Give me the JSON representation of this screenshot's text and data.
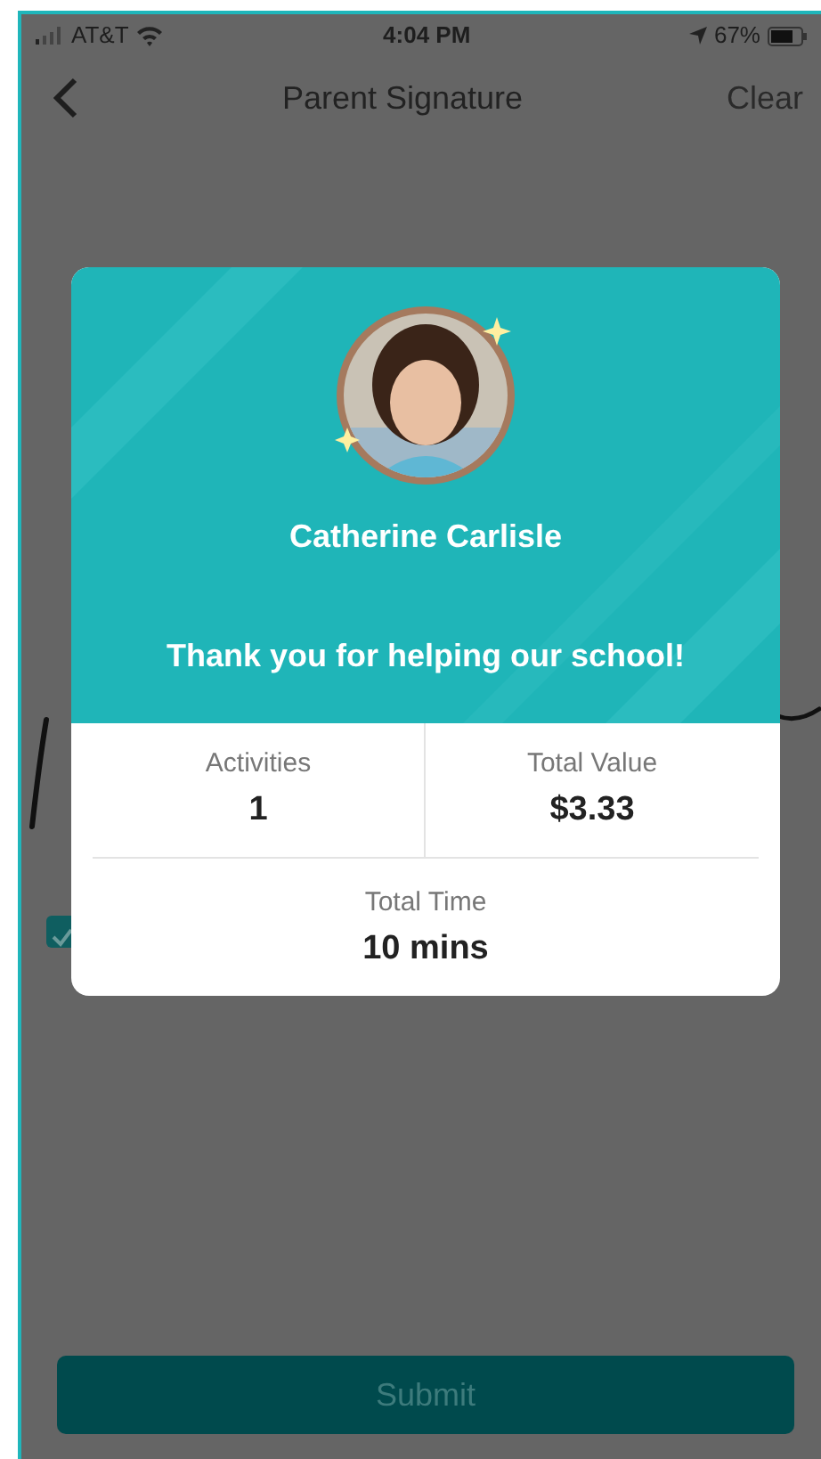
{
  "status_bar": {
    "carrier": "AT&T",
    "time": "4:04 PM",
    "battery": "67%"
  },
  "nav": {
    "title": "Parent Signature",
    "action": "Clear"
  },
  "agreement": {
    "checked": true
  },
  "submit": {
    "label": "Submit"
  },
  "modal": {
    "name": "Catherine Carlisle",
    "message": "Thank you for helping our school!",
    "stats": [
      {
        "label": "Activities",
        "value": "1"
      },
      {
        "label": "Total Value",
        "value": "$3.33"
      },
      {
        "label": "Total Time",
        "value": "10 mins"
      }
    ]
  }
}
